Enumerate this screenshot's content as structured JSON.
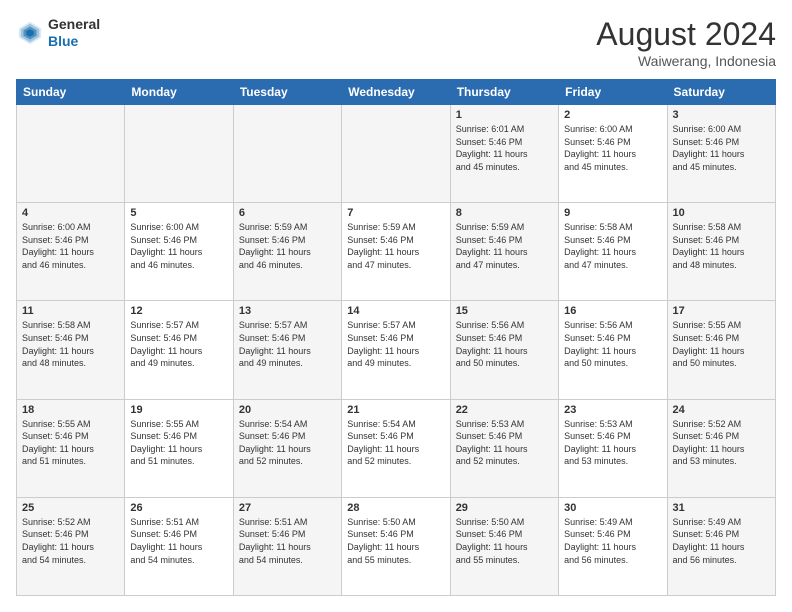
{
  "header": {
    "logo_general": "General",
    "logo_blue": "Blue",
    "month_year": "August 2024",
    "location": "Waiwerang, Indonesia"
  },
  "weekdays": [
    "Sunday",
    "Monday",
    "Tuesday",
    "Wednesday",
    "Thursday",
    "Friday",
    "Saturday"
  ],
  "weeks": [
    [
      {
        "day": "",
        "info": ""
      },
      {
        "day": "",
        "info": ""
      },
      {
        "day": "",
        "info": ""
      },
      {
        "day": "",
        "info": ""
      },
      {
        "day": "1",
        "info": "Sunrise: 6:01 AM\nSunset: 5:46 PM\nDaylight: 11 hours\nand 45 minutes."
      },
      {
        "day": "2",
        "info": "Sunrise: 6:00 AM\nSunset: 5:46 PM\nDaylight: 11 hours\nand 45 minutes."
      },
      {
        "day": "3",
        "info": "Sunrise: 6:00 AM\nSunset: 5:46 PM\nDaylight: 11 hours\nand 45 minutes."
      }
    ],
    [
      {
        "day": "4",
        "info": "Sunrise: 6:00 AM\nSunset: 5:46 PM\nDaylight: 11 hours\nand 46 minutes."
      },
      {
        "day": "5",
        "info": "Sunrise: 6:00 AM\nSunset: 5:46 PM\nDaylight: 11 hours\nand 46 minutes."
      },
      {
        "day": "6",
        "info": "Sunrise: 5:59 AM\nSunset: 5:46 PM\nDaylight: 11 hours\nand 46 minutes."
      },
      {
        "day": "7",
        "info": "Sunrise: 5:59 AM\nSunset: 5:46 PM\nDaylight: 11 hours\nand 47 minutes."
      },
      {
        "day": "8",
        "info": "Sunrise: 5:59 AM\nSunset: 5:46 PM\nDaylight: 11 hours\nand 47 minutes."
      },
      {
        "day": "9",
        "info": "Sunrise: 5:58 AM\nSunset: 5:46 PM\nDaylight: 11 hours\nand 47 minutes."
      },
      {
        "day": "10",
        "info": "Sunrise: 5:58 AM\nSunset: 5:46 PM\nDaylight: 11 hours\nand 48 minutes."
      }
    ],
    [
      {
        "day": "11",
        "info": "Sunrise: 5:58 AM\nSunset: 5:46 PM\nDaylight: 11 hours\nand 48 minutes."
      },
      {
        "day": "12",
        "info": "Sunrise: 5:57 AM\nSunset: 5:46 PM\nDaylight: 11 hours\nand 49 minutes."
      },
      {
        "day": "13",
        "info": "Sunrise: 5:57 AM\nSunset: 5:46 PM\nDaylight: 11 hours\nand 49 minutes."
      },
      {
        "day": "14",
        "info": "Sunrise: 5:57 AM\nSunset: 5:46 PM\nDaylight: 11 hours\nand 49 minutes."
      },
      {
        "day": "15",
        "info": "Sunrise: 5:56 AM\nSunset: 5:46 PM\nDaylight: 11 hours\nand 50 minutes."
      },
      {
        "day": "16",
        "info": "Sunrise: 5:56 AM\nSunset: 5:46 PM\nDaylight: 11 hours\nand 50 minutes."
      },
      {
        "day": "17",
        "info": "Sunrise: 5:55 AM\nSunset: 5:46 PM\nDaylight: 11 hours\nand 50 minutes."
      }
    ],
    [
      {
        "day": "18",
        "info": "Sunrise: 5:55 AM\nSunset: 5:46 PM\nDaylight: 11 hours\nand 51 minutes."
      },
      {
        "day": "19",
        "info": "Sunrise: 5:55 AM\nSunset: 5:46 PM\nDaylight: 11 hours\nand 51 minutes."
      },
      {
        "day": "20",
        "info": "Sunrise: 5:54 AM\nSunset: 5:46 PM\nDaylight: 11 hours\nand 52 minutes."
      },
      {
        "day": "21",
        "info": "Sunrise: 5:54 AM\nSunset: 5:46 PM\nDaylight: 11 hours\nand 52 minutes."
      },
      {
        "day": "22",
        "info": "Sunrise: 5:53 AM\nSunset: 5:46 PM\nDaylight: 11 hours\nand 52 minutes."
      },
      {
        "day": "23",
        "info": "Sunrise: 5:53 AM\nSunset: 5:46 PM\nDaylight: 11 hours\nand 53 minutes."
      },
      {
        "day": "24",
        "info": "Sunrise: 5:52 AM\nSunset: 5:46 PM\nDaylight: 11 hours\nand 53 minutes."
      }
    ],
    [
      {
        "day": "25",
        "info": "Sunrise: 5:52 AM\nSunset: 5:46 PM\nDaylight: 11 hours\nand 54 minutes."
      },
      {
        "day": "26",
        "info": "Sunrise: 5:51 AM\nSunset: 5:46 PM\nDaylight: 11 hours\nand 54 minutes."
      },
      {
        "day": "27",
        "info": "Sunrise: 5:51 AM\nSunset: 5:46 PM\nDaylight: 11 hours\nand 54 minutes."
      },
      {
        "day": "28",
        "info": "Sunrise: 5:50 AM\nSunset: 5:46 PM\nDaylight: 11 hours\nand 55 minutes."
      },
      {
        "day": "29",
        "info": "Sunrise: 5:50 AM\nSunset: 5:46 PM\nDaylight: 11 hours\nand 55 minutes."
      },
      {
        "day": "30",
        "info": "Sunrise: 5:49 AM\nSunset: 5:46 PM\nDaylight: 11 hours\nand 56 minutes."
      },
      {
        "day": "31",
        "info": "Sunrise: 5:49 AM\nSunset: 5:46 PM\nDaylight: 11 hours\nand 56 minutes."
      }
    ]
  ]
}
